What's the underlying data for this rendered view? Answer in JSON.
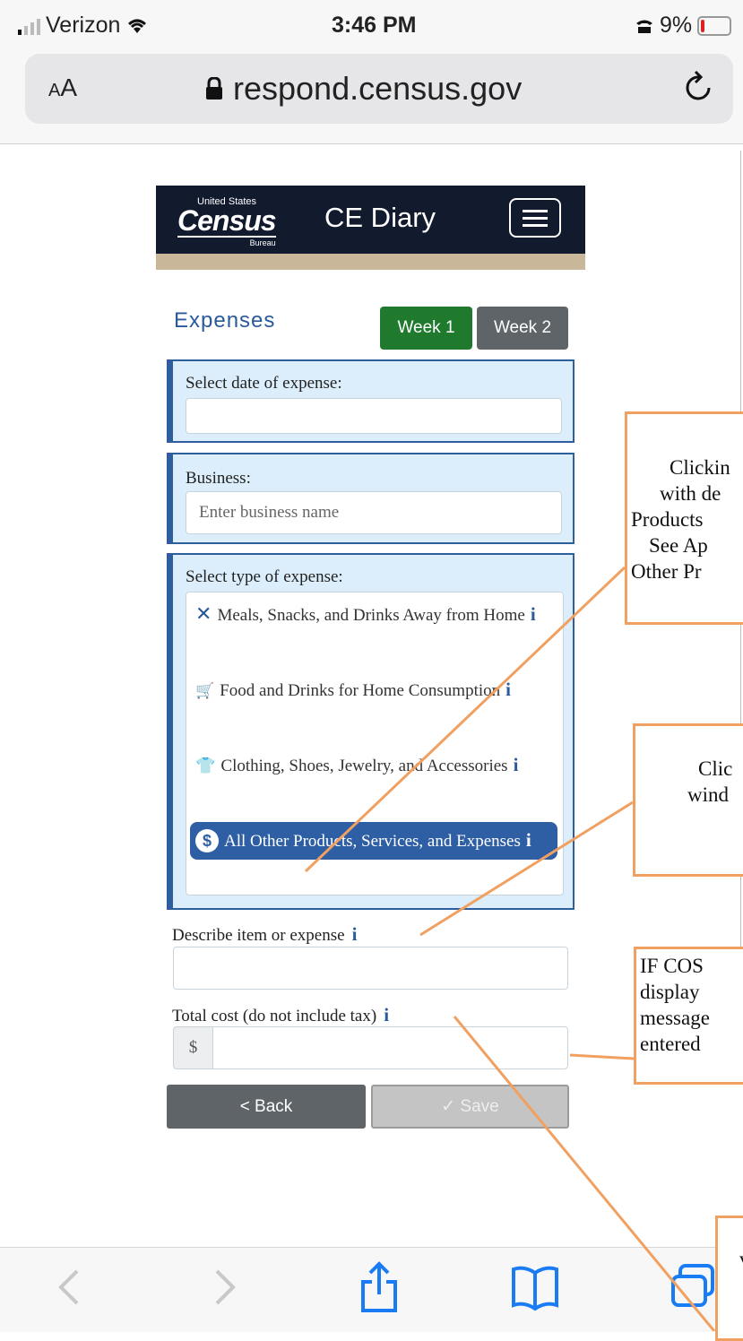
{
  "status_bar": {
    "carrier": "Verizon",
    "time": "3:46 PM",
    "battery": "9%"
  },
  "browser": {
    "text_size_small": "A",
    "text_size_large": "A",
    "host": "respond.census.gov"
  },
  "app": {
    "logo": {
      "top": "United States",
      "main": "Census",
      "bottom": "Bureau"
    },
    "title": "CE Diary"
  },
  "expenses": {
    "title": "Expenses",
    "week_tabs": [
      "Week 1",
      "Week 2"
    ],
    "date_label": "Select date of expense:",
    "date_value": "",
    "business_label": "Business:",
    "business_placeholder": "Enter business name",
    "type_label": "Select type of expense:",
    "types": [
      {
        "icon": "utensils-icon",
        "label": "Meals, Snacks, and Drinks Away from Home",
        "info": "i"
      },
      {
        "icon": "cart-icon",
        "label": "Food and Drinks for Home Consumption",
        "info": "i"
      },
      {
        "icon": "shirt-icon",
        "label": "Clothing, Shoes, Jewelry, and Accessories",
        "info": "i"
      },
      {
        "icon": "dollar-icon",
        "label": "All Other Products, Services, and Expenses",
        "info": "i",
        "selected": true
      }
    ],
    "describe_label": "Describe item or expense",
    "describe_info": "i",
    "cost_label": "Total cost (do not include tax)",
    "cost_info": "i",
    "currency_symbol": "$",
    "back_label": "< Back",
    "save_label": "✓ Save"
  },
  "annotations": {
    "callout1": [
      "Clickin",
      "with de",
      "Products",
      "See Ap",
      "Other Pr"
    ],
    "callout2": [
      "Clic",
      "wind"
    ],
    "callout3": [
      "IF COS",
      "display",
      "message",
      "entered"
    ],
    "callout4": [
      "v"
    ]
  },
  "colors": {
    "header_bg": "#121a2e",
    "accent_blue": "#2e5fa5",
    "week1_green": "#1f7a2e",
    "annotation_orange": "#f0a060"
  }
}
